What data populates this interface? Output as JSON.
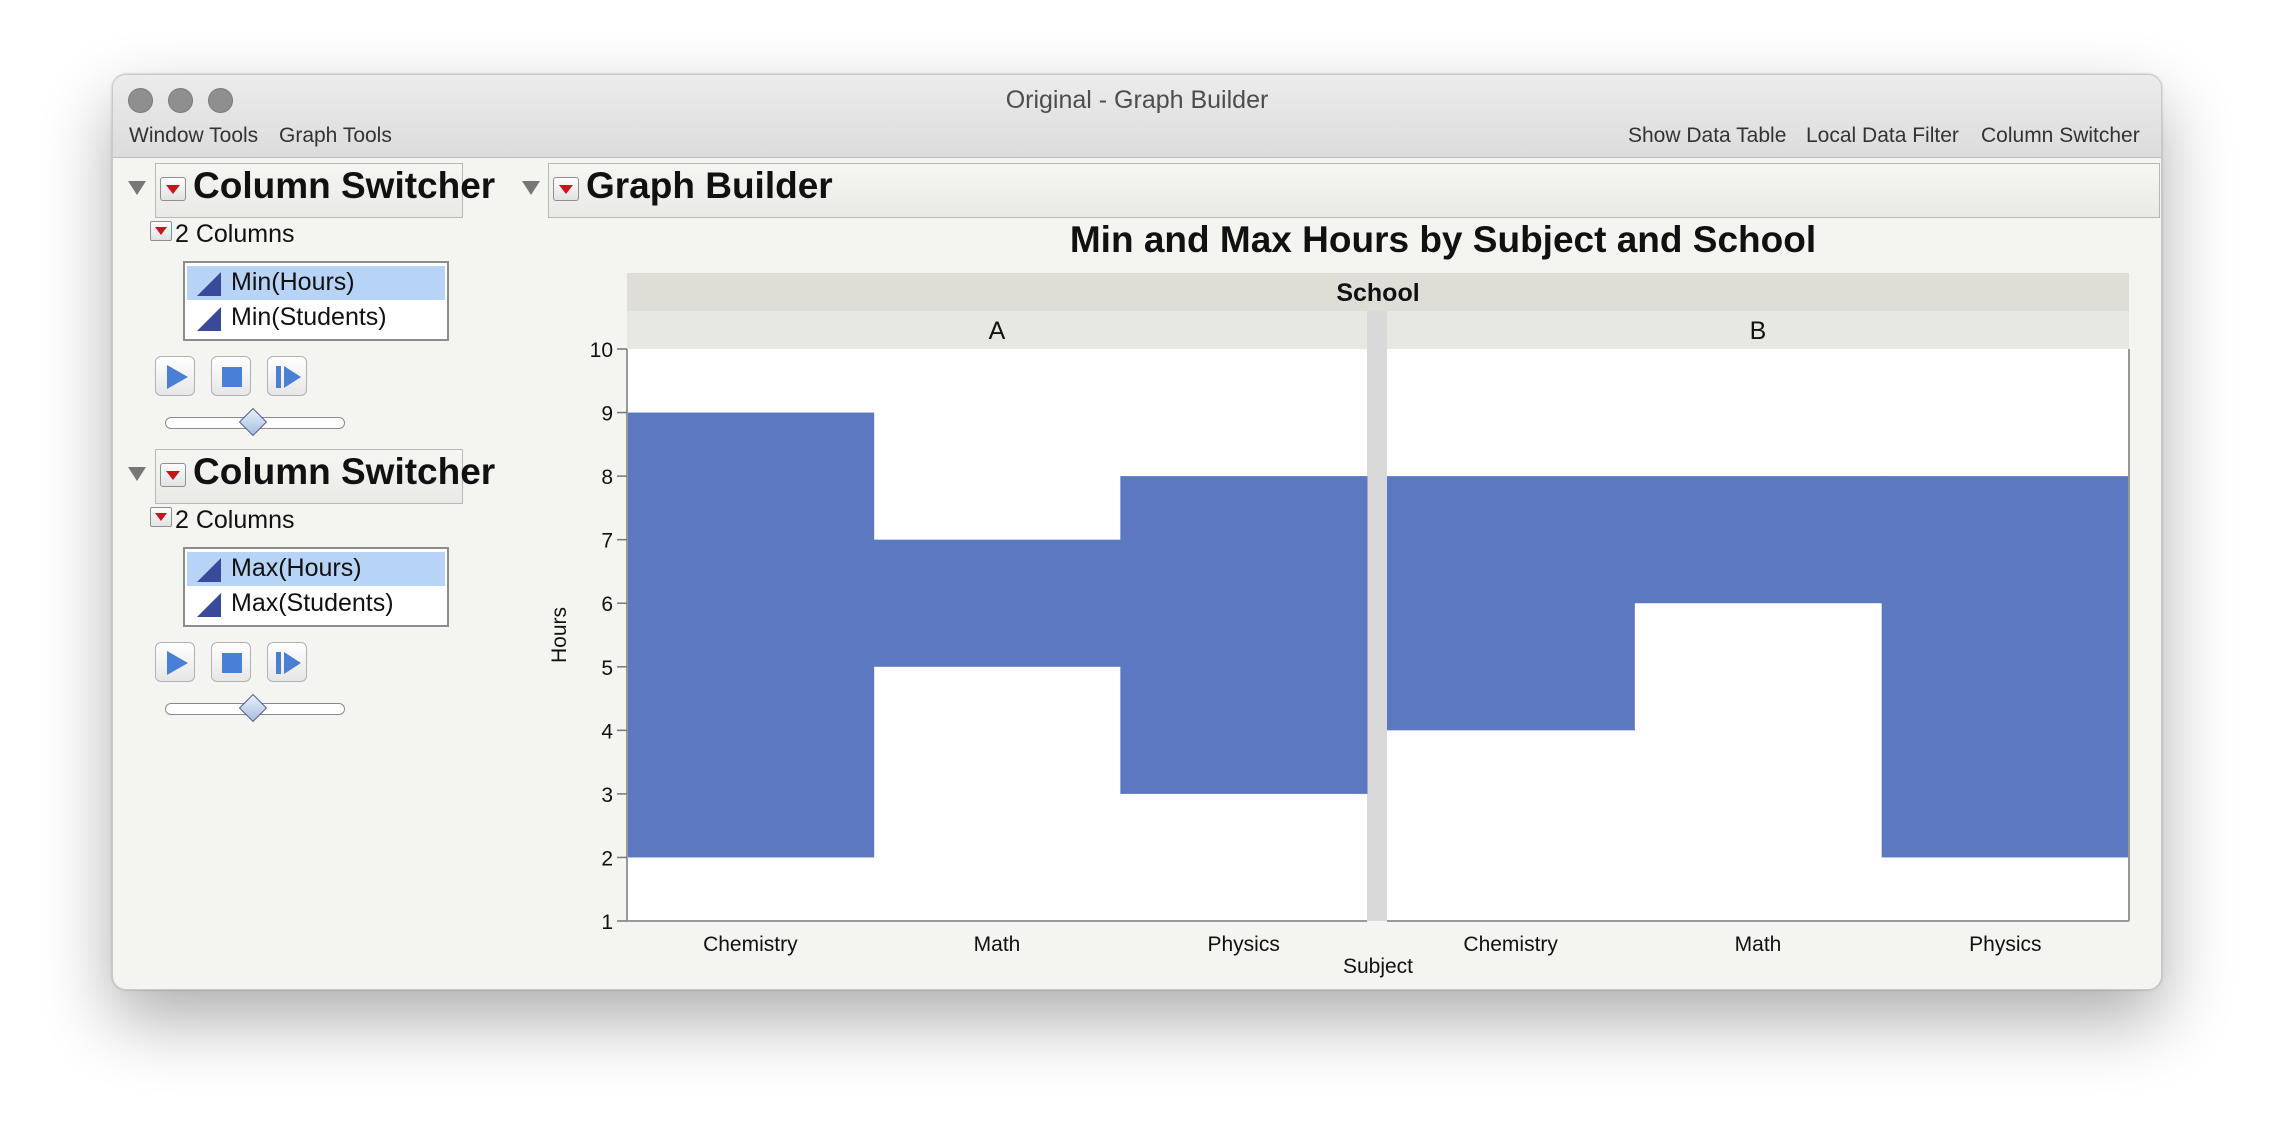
{
  "window": {
    "title": "Original - Graph Builder",
    "menu_left": [
      "Window Tools",
      "Graph Tools"
    ],
    "menu_right": [
      "Show Data Table",
      "Local Data Filter",
      "Column Switcher"
    ]
  },
  "switchers": [
    {
      "title": "Column Switcher",
      "columns_label": "2 Columns",
      "items": [
        {
          "label": "Min(Hours)",
          "selected": true
        },
        {
          "label": "Min(Students)",
          "selected": false
        }
      ],
      "slider_position": 0.5
    },
    {
      "title": "Column Switcher",
      "columns_label": "2 Columns",
      "items": [
        {
          "label": "Max(Hours)",
          "selected": true
        },
        {
          "label": "Max(Students)",
          "selected": false
        }
      ],
      "slider_position": 0.5
    }
  ],
  "graph_builder": {
    "title": "Graph Builder"
  },
  "colors": {
    "bar": "#5b78c0",
    "panel_header": "#dfded6",
    "subheader": "#e8e8e3",
    "gutter": "#d9d9d9"
  },
  "chart_data": {
    "type": "bar",
    "chart_style": "floating range bars (min to max)",
    "title": "Min and Max Hours by Subject and School",
    "group_label": "School",
    "panels": [
      {
        "name": "A",
        "categories": [
          "Chemistry",
          "Math",
          "Physics"
        ],
        "min": [
          2,
          5,
          3
        ],
        "max": [
          9,
          7,
          8
        ]
      },
      {
        "name": "B",
        "categories": [
          "Chemistry",
          "Math",
          "Physics"
        ],
        "min": [
          4,
          6,
          2
        ],
        "max": [
          8,
          8,
          8
        ]
      }
    ],
    "xlabel": "Subject",
    "ylabel": "Hours",
    "ylim": [
      1,
      10
    ],
    "yticks": [
      "1",
      "2",
      "3",
      "4",
      "5",
      "6",
      "7",
      "8",
      "9",
      "10"
    ],
    "grid": false
  }
}
